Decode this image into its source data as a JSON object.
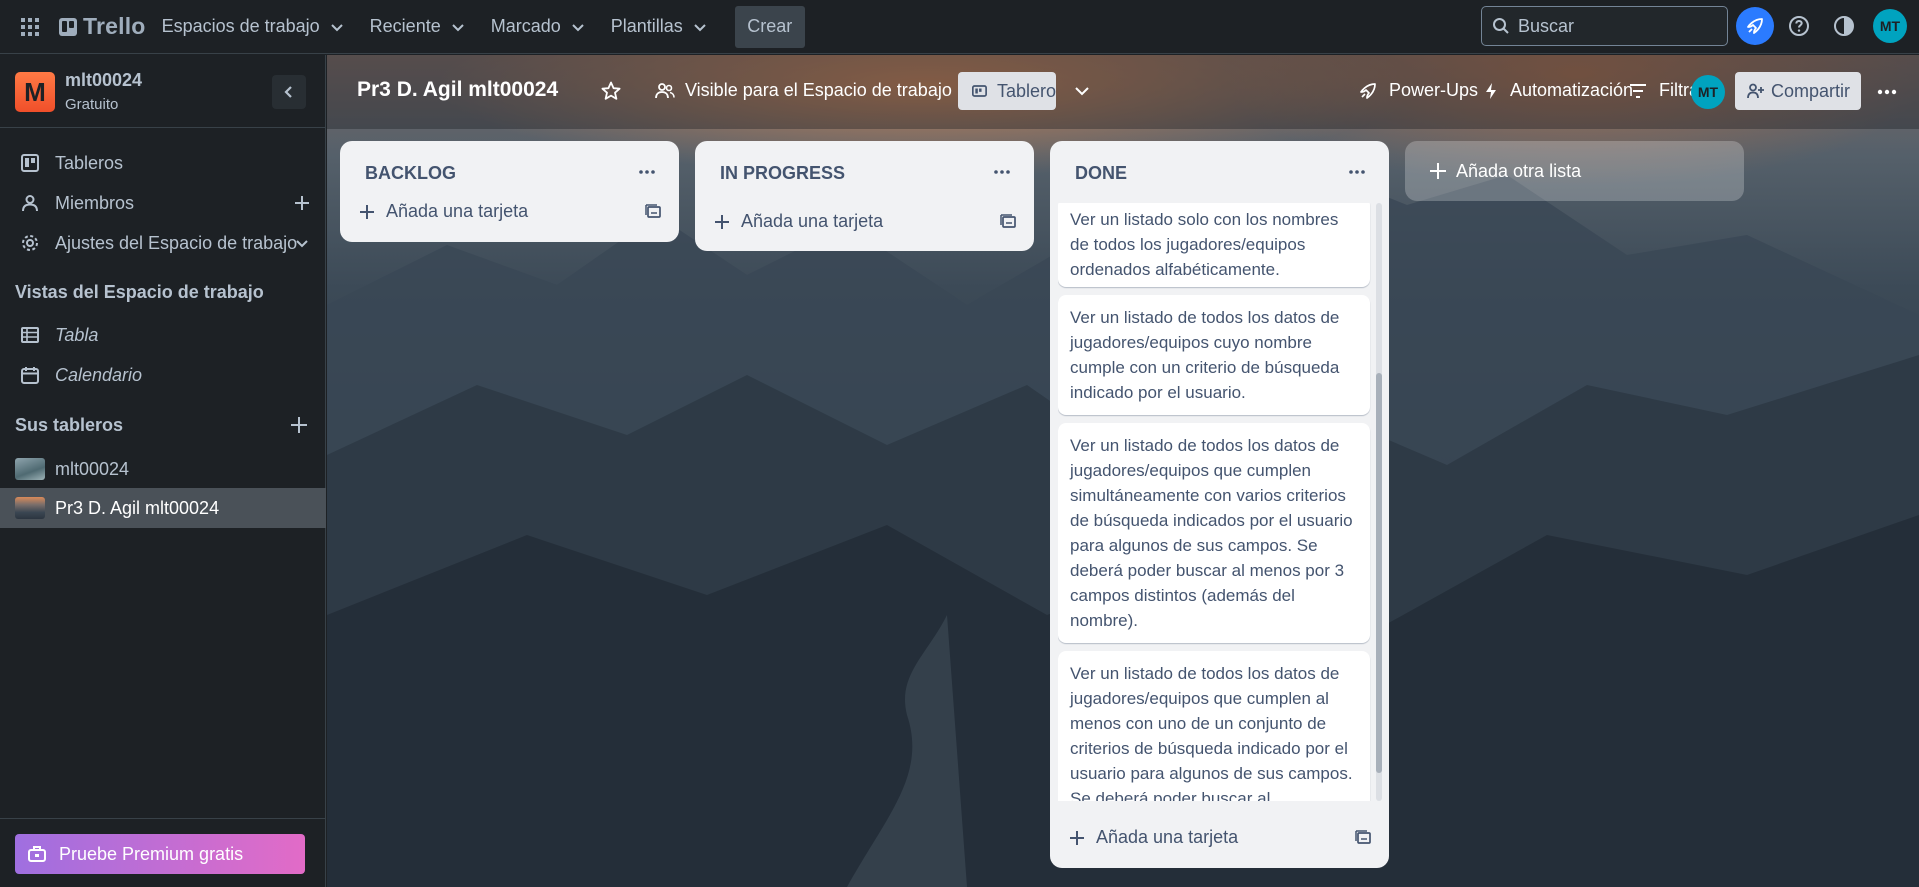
{
  "topnav": {
    "logo_text": "Trello",
    "menus": [
      "Espacios de trabajo",
      "Reciente",
      "Marcado",
      "Plantillas"
    ],
    "create_label": "Crear",
    "search_placeholder": "Buscar",
    "avatar_initials": "MT"
  },
  "sidebar": {
    "workspace_initial": "M",
    "workspace_name": "mlt00024",
    "workspace_plan": "Gratuito",
    "items": [
      {
        "label": "Tableros",
        "icon": "board-icon"
      },
      {
        "label": "Miembros",
        "icon": "person-icon"
      },
      {
        "label": "Ajustes del Espacio de trabajo",
        "icon": "gear-icon"
      }
    ],
    "views_heading": "Vistas del Espacio de trabajo",
    "views": [
      {
        "label": "Tabla",
        "icon": "table-icon"
      },
      {
        "label": "Calendario",
        "icon": "calendar-icon"
      }
    ],
    "boards_heading": "Sus tableros",
    "boards": [
      {
        "label": "mlt00024"
      },
      {
        "label": "Pr3 D. Agil mlt00024"
      }
    ],
    "premium_label": "Pruebe Premium gratis"
  },
  "board": {
    "title": "Pr3 D. Agil mlt00024",
    "visibility": "Visible para el Espacio de trabajo",
    "view_label": "Tablero",
    "powerups_label": "Power-Ups",
    "automation_label": "Automatización",
    "filter_label": "Filtrar",
    "member_initials": "MT",
    "share_label": "Compartir",
    "add_list_label": "Añada otra lista"
  },
  "lists": [
    {
      "title": "BACKLOG",
      "add_card": "Añada una tarjeta",
      "cards": []
    },
    {
      "title": "IN PROGRESS",
      "add_card": "Añada una tarjeta",
      "cards": []
    },
    {
      "title": "DONE",
      "add_card": "Añada una tarjeta",
      "cards": [
        "Ver un listado solo con los nombres de todos los jugadores/equipos ordenados alfabéticamente.",
        "Ver un listado de todos los datos de jugadores/equipos cuyo nombre cumple con un criterio de búsqueda indicado por el usuario.",
        "Ver un listado de todos los datos de jugadores/equipos que cumplen simultáneamente con varios criterios de búsqueda indicados por el usuario para algunos de sus campos. Se deberá poder buscar al menos por 3 campos distintos (además del nombre).",
        "Ver un listado de todos los datos de jugadores/equipos que cumplen al menos con uno de un conjunto de criterios de búsqueda indicado por el usuario para algunos de sus campos. Se deberá poder buscar al"
      ]
    }
  ],
  "colors": {
    "header_bg": "#1d2125",
    "list_bg": "#f1f2f4",
    "accent_blue": "#2b7bff",
    "avatar": "#00a3bf",
    "premium_gradient": [
      "#9f6fe0",
      "#e26bc7"
    ]
  }
}
